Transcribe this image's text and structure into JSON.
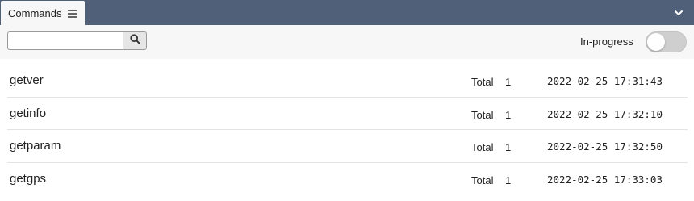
{
  "panel": {
    "tab_label": "Commands",
    "tab_menu_icon": "hamburger-icon",
    "collapse_icon": "chevron-down-icon"
  },
  "toolbar": {
    "search_value": "",
    "search_placeholder": "",
    "search_icon": "search-icon",
    "inprogress_label": "In-progress",
    "inprogress_on": false
  },
  "commands": [
    {
      "name": "getver",
      "total_label": "Total",
      "total": "1",
      "time": "2022-02-25 17:31:43"
    },
    {
      "name": "getinfo",
      "total_label": "Total",
      "total": "1",
      "time": "2022-02-25 17:32:10"
    },
    {
      "name": "getparam",
      "total_label": "Total",
      "total": "1",
      "time": "2022-02-25 17:32:50"
    },
    {
      "name": "getgps",
      "total_label": "Total",
      "total": "1",
      "time": "2022-02-25 17:33:03"
    }
  ],
  "colors": {
    "header_bg": "#4f6078",
    "toolbar_bg": "#f7f7f7",
    "toggle_off": "#cfcfcf"
  }
}
